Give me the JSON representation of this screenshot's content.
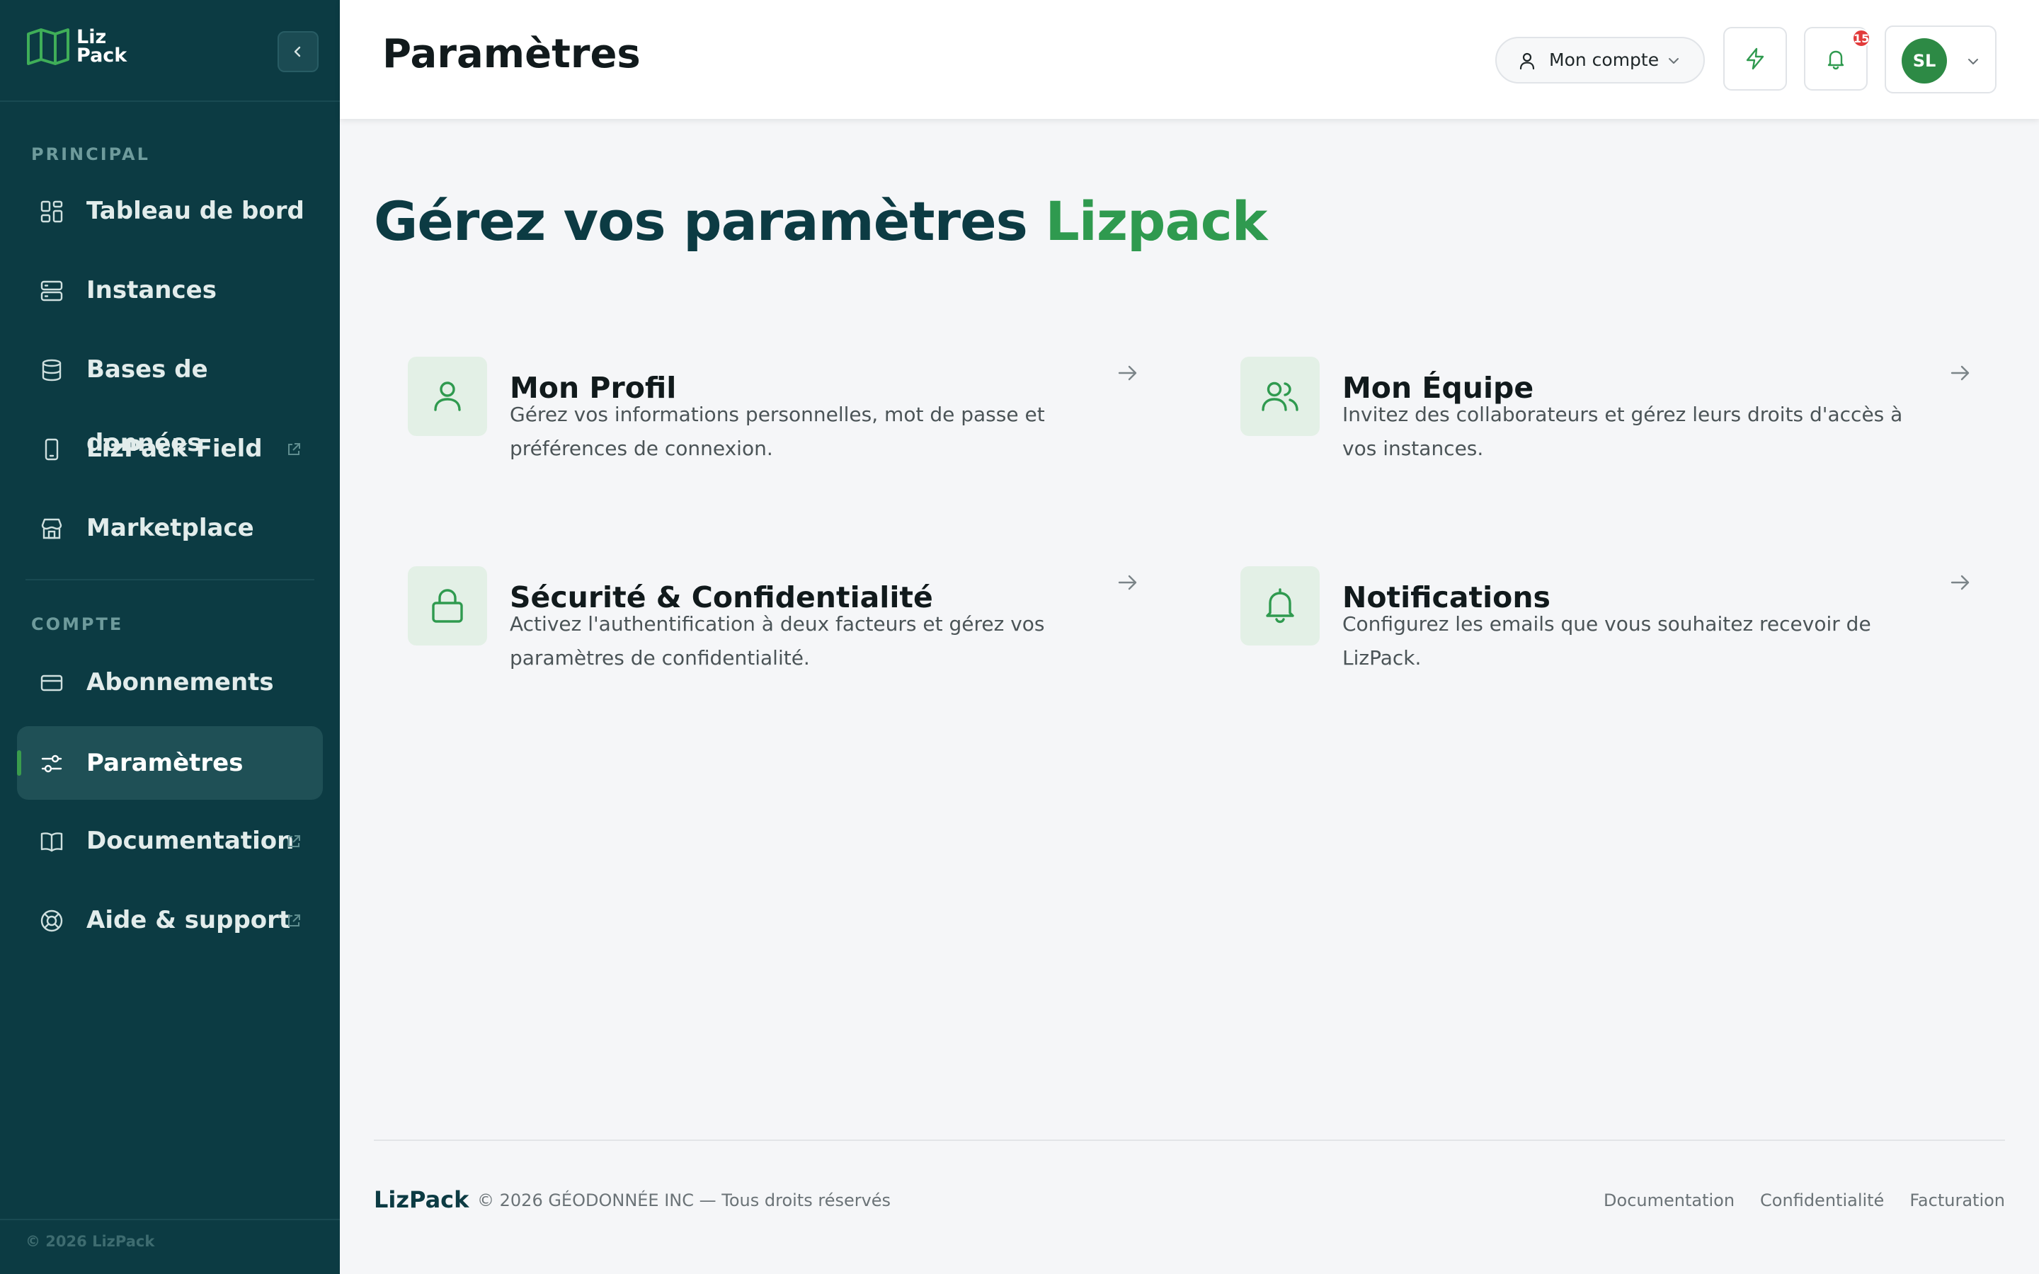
{
  "brand": {
    "line1": "Liz",
    "line2": "Pack"
  },
  "sidebar": {
    "sections": [
      {
        "label": "PRINCIPAL"
      },
      {
        "label": "COMPTE"
      }
    ],
    "items": [
      {
        "label": "Tableau de bord",
        "icon": "dashboard-grid-icon",
        "external": false
      },
      {
        "label": "Instances",
        "icon": "server-icon",
        "external": false
      },
      {
        "label": "Bases de données",
        "icon": "database-icon",
        "external": false
      },
      {
        "label": "LizPack Field",
        "icon": "mobile-icon",
        "external": true
      },
      {
        "label": "Marketplace",
        "icon": "store-icon",
        "external": false
      },
      {
        "label": "Abonnements",
        "icon": "credit-card-icon",
        "external": false
      },
      {
        "label": "Paramètres",
        "icon": "sliders-icon",
        "external": false,
        "active": true
      },
      {
        "label": "Documentation",
        "icon": "book-icon",
        "external": true
      },
      {
        "label": "Aide & support",
        "icon": "lifebuoy-icon",
        "external": true
      }
    ],
    "footer": "© 2026 LizPack"
  },
  "header": {
    "title": "Paramètres",
    "account_label": "Mon compte",
    "notification_count": "15",
    "avatar_initials": "SL"
  },
  "main": {
    "hero_prefix": "Gérez vos paramètres ",
    "hero_accent": "Lizpack",
    "cards": [
      {
        "title": "Mon Profil",
        "description": "Gérez vos informations personnelles, mot de passe et préférences de connexion.",
        "icon": "user-icon"
      },
      {
        "title": "Mon Équipe",
        "description": "Invitez des collaborateurs et gérez leurs droits d'accès à vos instances.",
        "icon": "users-icon"
      },
      {
        "title": "Sécurité & Confidentialité",
        "description": "Activez l'authentification à deux facteurs et gérez vos paramètres de confidentialité.",
        "icon": "lock-icon"
      },
      {
        "title": "Notifications",
        "description": "Configurez les emails que vous souhaitez recevoir de LizPack.",
        "icon": "bell-icon"
      }
    ]
  },
  "footer": {
    "brand": "LizPack",
    "copyright": "© 2026 GÉODONNÉE INC — Tous droits réservés",
    "links": [
      "Documentation",
      "Confidentialité",
      "Facturation"
    ]
  },
  "colors": {
    "sidebar_bg": "#0c3b43",
    "accent_green": "#2f9a4f",
    "icon_box_bg": "#e3f0e6",
    "badge_red": "#e23b3b"
  }
}
